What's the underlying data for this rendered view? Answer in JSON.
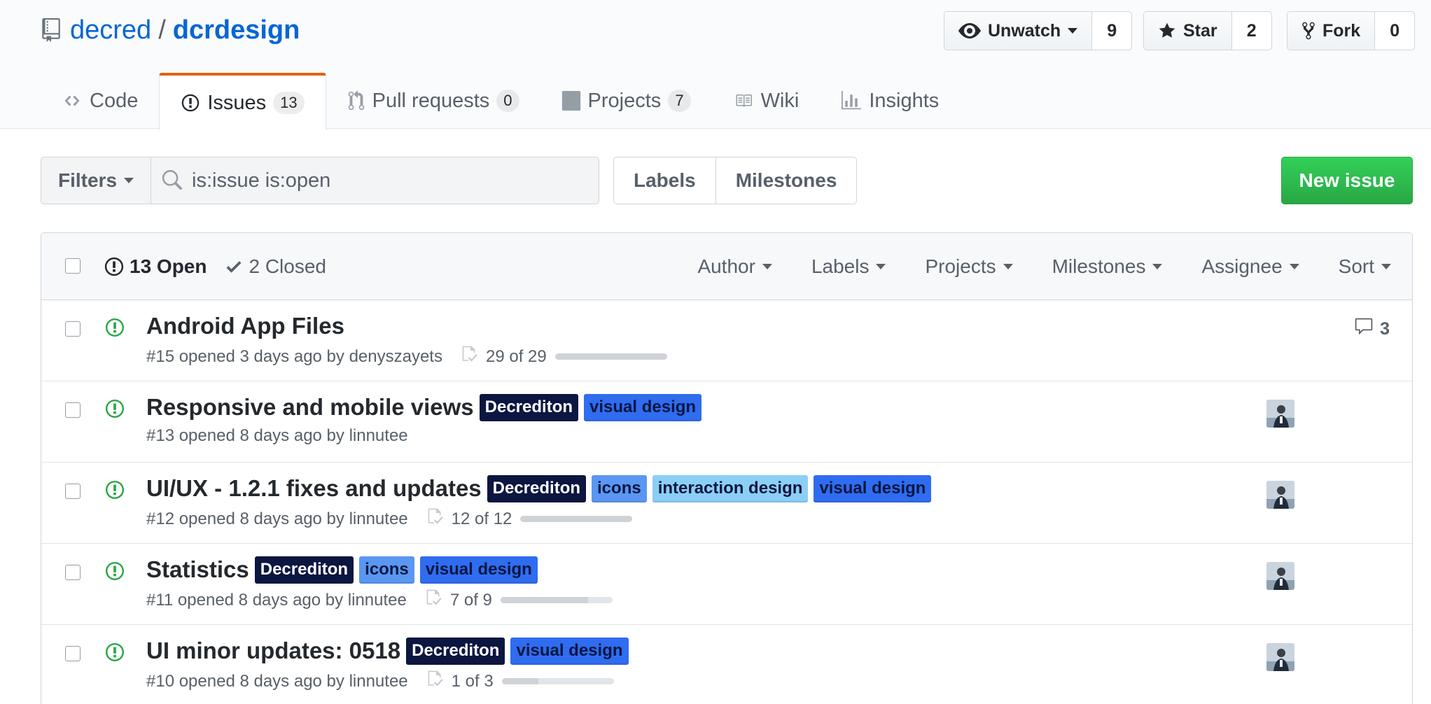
{
  "repo": {
    "owner": "decred",
    "separator": "/",
    "name": "dcrdesign"
  },
  "actions": {
    "watch": {
      "label": "Unwatch",
      "count": "9"
    },
    "star": {
      "label": "Star",
      "count": "2"
    },
    "fork": {
      "label": "Fork",
      "count": "0"
    }
  },
  "tabs": [
    {
      "label": "Code",
      "count": null,
      "icon": "code-icon"
    },
    {
      "label": "Issues",
      "count": "13",
      "icon": "issue-opened-icon",
      "active": true
    },
    {
      "label": "Pull requests",
      "count": "0",
      "icon": "git-pull-request-icon"
    },
    {
      "label": "Projects",
      "count": "7",
      "icon": "project-icon"
    },
    {
      "label": "Wiki",
      "count": null,
      "icon": "book-icon"
    },
    {
      "label": "Insights",
      "count": null,
      "icon": "graph-icon"
    }
  ],
  "filter_bar": {
    "filters_label": "Filters",
    "search_value": "is:issue is:open",
    "labels_button": "Labels",
    "milestones_button": "Milestones",
    "new_issue_button": "New issue"
  },
  "issues_header": {
    "open_label": "13 Open",
    "closed_label": "2 Closed",
    "filters": [
      "Author",
      "Labels",
      "Projects",
      "Milestones",
      "Assignee",
      "Sort"
    ]
  },
  "label_colors": {
    "Decrediton": {
      "bg": "#0b1641",
      "fg": "#ffffff"
    },
    "visual design": {
      "bg": "#2f6cf0",
      "fg": "#0b1641"
    },
    "icons": {
      "bg": "#5a97f2",
      "fg": "#0b1641"
    },
    "interaction design": {
      "bg": "#8bcff7",
      "fg": "#0b1641"
    }
  },
  "issues": [
    {
      "title": "Android App Files",
      "labels": [],
      "meta": "#15 opened 3 days ago by denyszayets",
      "tasks": "29 of 29",
      "progress": 1.0,
      "comments": "3",
      "assignee": false
    },
    {
      "title": "Responsive and mobile views",
      "labels": [
        "Decrediton",
        "visual design"
      ],
      "meta": "#13 opened 8 days ago by linnutee",
      "tasks": null,
      "progress": null,
      "comments": null,
      "assignee": true
    },
    {
      "title": "UI/UX - 1.2.1 fixes and updates",
      "labels": [
        "Decrediton",
        "icons",
        "interaction design",
        "visual design"
      ],
      "meta": "#12 opened 8 days ago by linnutee",
      "tasks": "12 of 12",
      "progress": 1.0,
      "comments": null,
      "assignee": true
    },
    {
      "title": "Statistics",
      "labels": [
        "Decrediton",
        "icons",
        "visual design"
      ],
      "meta": "#11 opened 8 days ago by linnutee",
      "tasks": "7 of 9",
      "progress": 0.78,
      "comments": null,
      "assignee": true
    },
    {
      "title": "UI minor updates: 0518",
      "labels": [
        "Decrediton",
        "visual design"
      ],
      "meta": "#10 opened 8 days ago by linnutee",
      "tasks": "1 of 3",
      "progress": 0.33,
      "comments": null,
      "assignee": true
    }
  ]
}
